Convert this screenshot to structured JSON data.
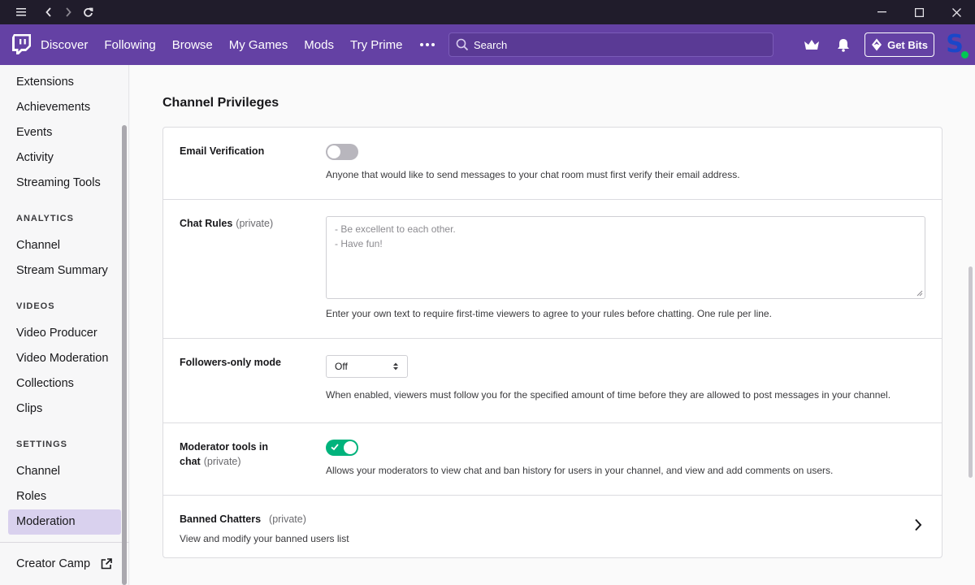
{
  "nav": {
    "items": [
      "Discover",
      "Following",
      "Browse",
      "My Games",
      "Mods",
      "Try Prime"
    ],
    "search_placeholder": "Search",
    "get_bits_label": "Get Bits",
    "avatar_letter": "S"
  },
  "sidebar": {
    "top_items": [
      "Extensions",
      "Achievements",
      "Events",
      "Activity",
      "Streaming Tools"
    ],
    "analytics_header": "ANALYTICS",
    "analytics_items": [
      "Channel",
      "Stream Summary"
    ],
    "videos_header": "VIDEOS",
    "videos_items": [
      "Video Producer",
      "Video Moderation",
      "Collections",
      "Clips"
    ],
    "settings_header": "SETTINGS",
    "settings_items": [
      "Channel",
      "Roles",
      "Moderation"
    ],
    "active_item": "Moderation",
    "footer_item": "Creator Camp"
  },
  "main": {
    "section_title": "Channel Privileges",
    "email": {
      "label": "Email Verification",
      "enabled": false,
      "help": "Anyone that would like to send messages to your chat room must first verify their email address."
    },
    "chat_rules": {
      "label": "Chat Rules",
      "tag": "(private)",
      "line1": "- Be excellent to each other.",
      "line2": "- Have fun!",
      "help": "Enter your own text to require first-time viewers to agree to your rules before chatting. One rule per line."
    },
    "followers": {
      "label": "Followers-only mode",
      "value": "Off",
      "help": "When enabled, viewers must follow you for the specified amount of time before they are allowed to post messages in your channel."
    },
    "mod_tools": {
      "label1": "Moderator tools in",
      "label2": "chat",
      "tag": "(private)",
      "enabled": true,
      "help": "Allows your moderators to view chat and ban history for users in your channel, and view and add comments on users."
    },
    "banned": {
      "label": "Banned Chatters",
      "tag": "(private)",
      "help": "View and modify your banned users list"
    }
  },
  "colors": {
    "brand": "#6441a4",
    "toggle_on": "#00b37c",
    "active_bg": "#d9d1ee"
  }
}
